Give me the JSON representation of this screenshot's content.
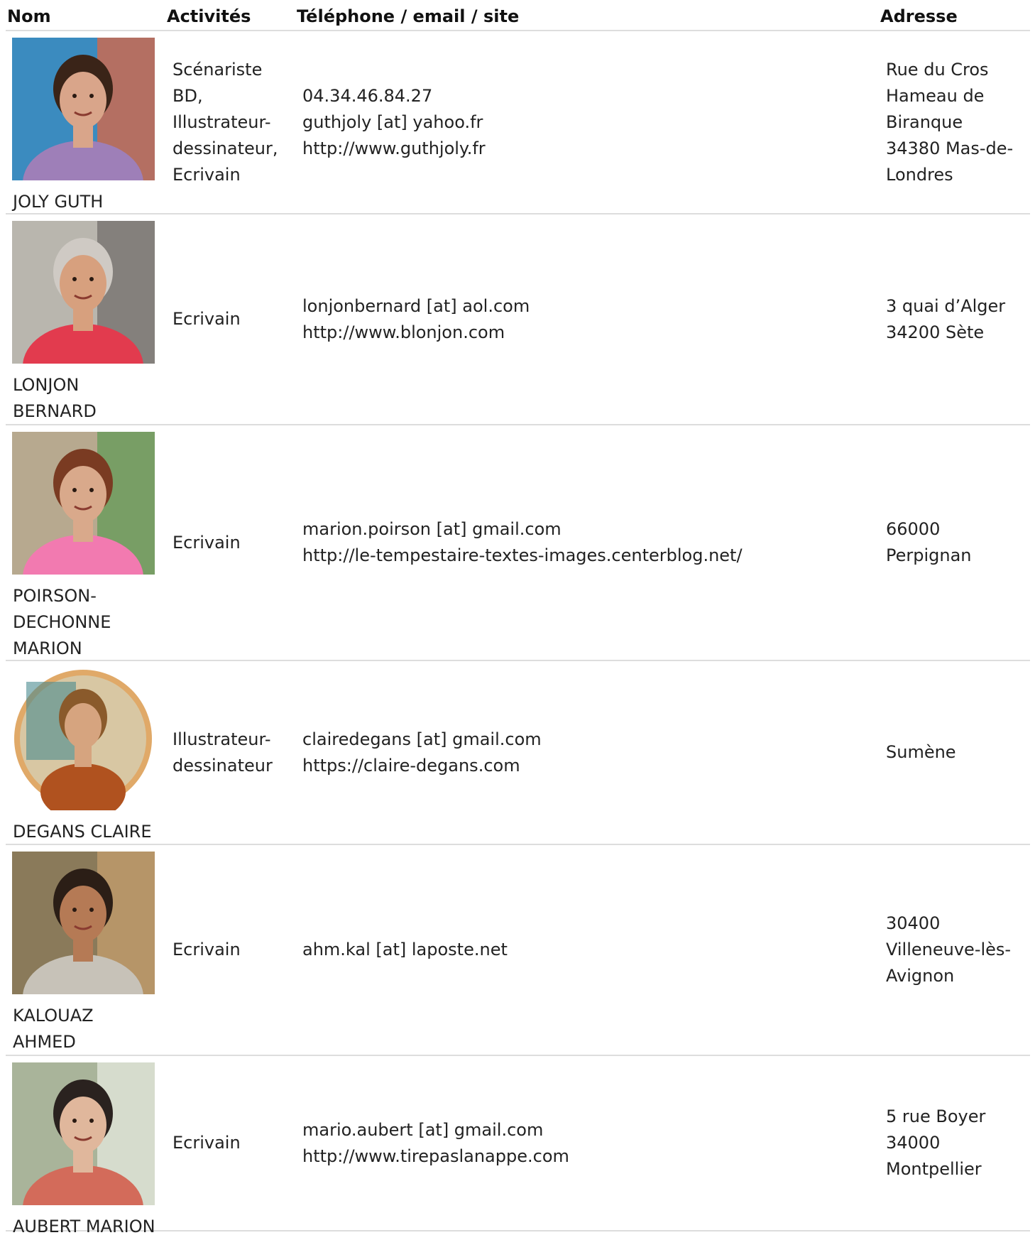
{
  "table": {
    "headers": {
      "nom": "Nom",
      "activites": "Activités",
      "contact": "Téléphone / email / site",
      "adresse": "Adresse"
    },
    "rows": [
      {
        "name_lines": [
          "JOLY GUTH"
        ],
        "activity_lines": [
          "Scénariste",
          "BD,",
          "Illustrateur-",
          "dessinateur,",
          "Ecrivain"
        ],
        "contact_lines": [
          "04.34.46.84.27",
          "guthjoly [at] yahoo.fr",
          "http://www.guthjoly.fr"
        ],
        "address_lines": [
          "Rue du Cros",
          "Hameau de",
          "Biranque",
          "34380 Mas-de-",
          "Londres"
        ]
      },
      {
        "name_lines": [
          "LONJON",
          "BERNARD"
        ],
        "activity_lines": [
          "Ecrivain"
        ],
        "contact_lines": [
          "lonjonbernard [at] aol.com",
          "http://www.blonjon.com"
        ],
        "address_lines": [
          "3 quai d’Alger",
          "34200 Sète"
        ]
      },
      {
        "name_lines": [
          "POIRSON-",
          "DECHONNE",
          "MARION"
        ],
        "activity_lines": [
          "Ecrivain"
        ],
        "contact_lines": [
          "marion.poirson [at] gmail.com",
          "http://le-tempestaire-textes-images.centerblog.net/"
        ],
        "address_lines": [
          "66000",
          "Perpignan"
        ]
      },
      {
        "name_lines": [
          "DEGANS CLAIRE"
        ],
        "activity_lines": [
          "Illustrateur-",
          "dessinateur"
        ],
        "contact_lines": [
          "clairedegans [at] gmail.com",
          "https://claire-degans.com"
        ],
        "address_lines": [
          "Sumène"
        ]
      },
      {
        "name_lines": [
          "KALOUAZ",
          "AHMED"
        ],
        "activity_lines": [
          "Ecrivain"
        ],
        "contact_lines": [
          "ahm.kal [at] laposte.net"
        ],
        "address_lines": [
          "30400",
          "Villeneuve-lès-",
          "Avignon"
        ]
      },
      {
        "name_lines": [
          "AUBERT MARION"
        ],
        "activity_lines": [
          "Ecrivain"
        ],
        "contact_lines": [
          "mario.aubert [at] gmail.com",
          "http://www.tirepaslanappe.com"
        ],
        "address_lines": [
          "5 rue Boyer",
          "34000",
          "Montpellier"
        ]
      }
    ]
  },
  "colors": {
    "divider": "#dddddd",
    "header_text": "#111111",
    "body_text": "#222222",
    "photo_ring": "#e0a968"
  },
  "photo_icons": [
    "person-photo",
    "person-photo",
    "person-photo",
    "person-photo-round",
    "person-photo",
    "person-photo"
  ]
}
